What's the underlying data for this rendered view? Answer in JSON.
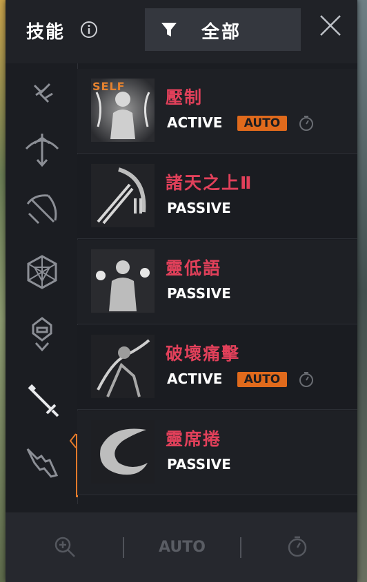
{
  "panel": {
    "title": "技能",
    "filter_label": "全部"
  },
  "sidebar": {
    "categories": [
      {
        "icon": "wings-feather-icon"
      },
      {
        "icon": "bow-arrow-icon"
      },
      {
        "icon": "crossbow-icon"
      },
      {
        "icon": "geometric-orb-icon"
      },
      {
        "icon": "hooded-figure-icon"
      },
      {
        "icon": "sword-icon",
        "selected": true
      },
      {
        "icon": "broken-blade-icon"
      }
    ]
  },
  "skills": [
    {
      "name": "壓制",
      "type": "ACTIVE",
      "auto": "AUTO",
      "self_tag": "SELF"
    },
    {
      "name": "諸天之上Ⅱ",
      "type": "PASSIVE"
    },
    {
      "name": "靈低語",
      "type": "PASSIVE"
    },
    {
      "name": "破壞痛擊",
      "type": "ACTIVE",
      "auto": "AUTO"
    },
    {
      "name": "靈席捲",
      "type": "PASSIVE"
    }
  ],
  "footer": {
    "auto_label": "AUTO"
  },
  "colors": {
    "accent": "#e06a1c",
    "skill_name": "#e1405a",
    "panel_bg": "#1b1d22"
  }
}
